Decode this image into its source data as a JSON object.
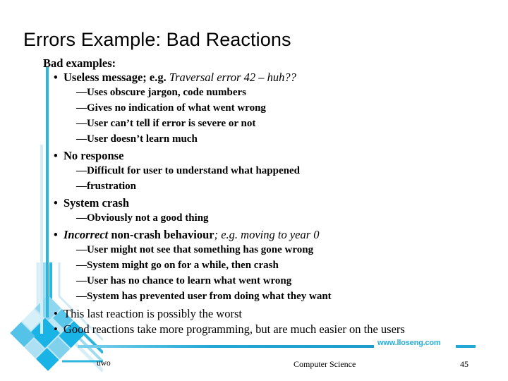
{
  "slide": {
    "title": "Errors Example: Bad Reactions",
    "intro": "Bad examples:",
    "bullets": [
      {
        "text_bold": "Useless message; e.g. ",
        "text_italic": "Traversal error 42 – huh??",
        "sub": [
          "—Uses obscure jargon, code numbers",
          "—Gives no indication of what went wrong",
          "—User can’t tell if error is severe or not",
          "—User doesn’t learn much"
        ]
      },
      {
        "text_bold": "No response",
        "text_italic": "",
        "sub": [
          "—Difficult for user to understand what happened",
          "—frustration"
        ]
      },
      {
        "text_bold": "System crash",
        "text_italic": "",
        "sub": [
          "—Obviously not a good thing"
        ]
      },
      {
        "text_bolditalic": "Incorrect",
        "text_bold": " non-crash behaviour",
        "text_italic": "; e.g. moving to year 0",
        "sub": [
          "—User might not see that something has gone wrong",
          "—System might go on for a while, then crash",
          "—User has no chance to learn what went wrong",
          "—System has prevented user from doing what they want"
        ]
      }
    ],
    "closing": [
      "This last reaction is possibly the worst",
      "Good reactions take more programming, but are much easier on the users"
    ],
    "bullet_glyph": "•"
  },
  "footer": {
    "url": "www.lloseng.com",
    "left": "uwo",
    "center": "Computer Science",
    "page": "45"
  },
  "colors": {
    "accent": "#2cb5dd",
    "accent_light": "#d3ecf6",
    "accent_deep": "#1d9ccb",
    "text": "#000000"
  }
}
